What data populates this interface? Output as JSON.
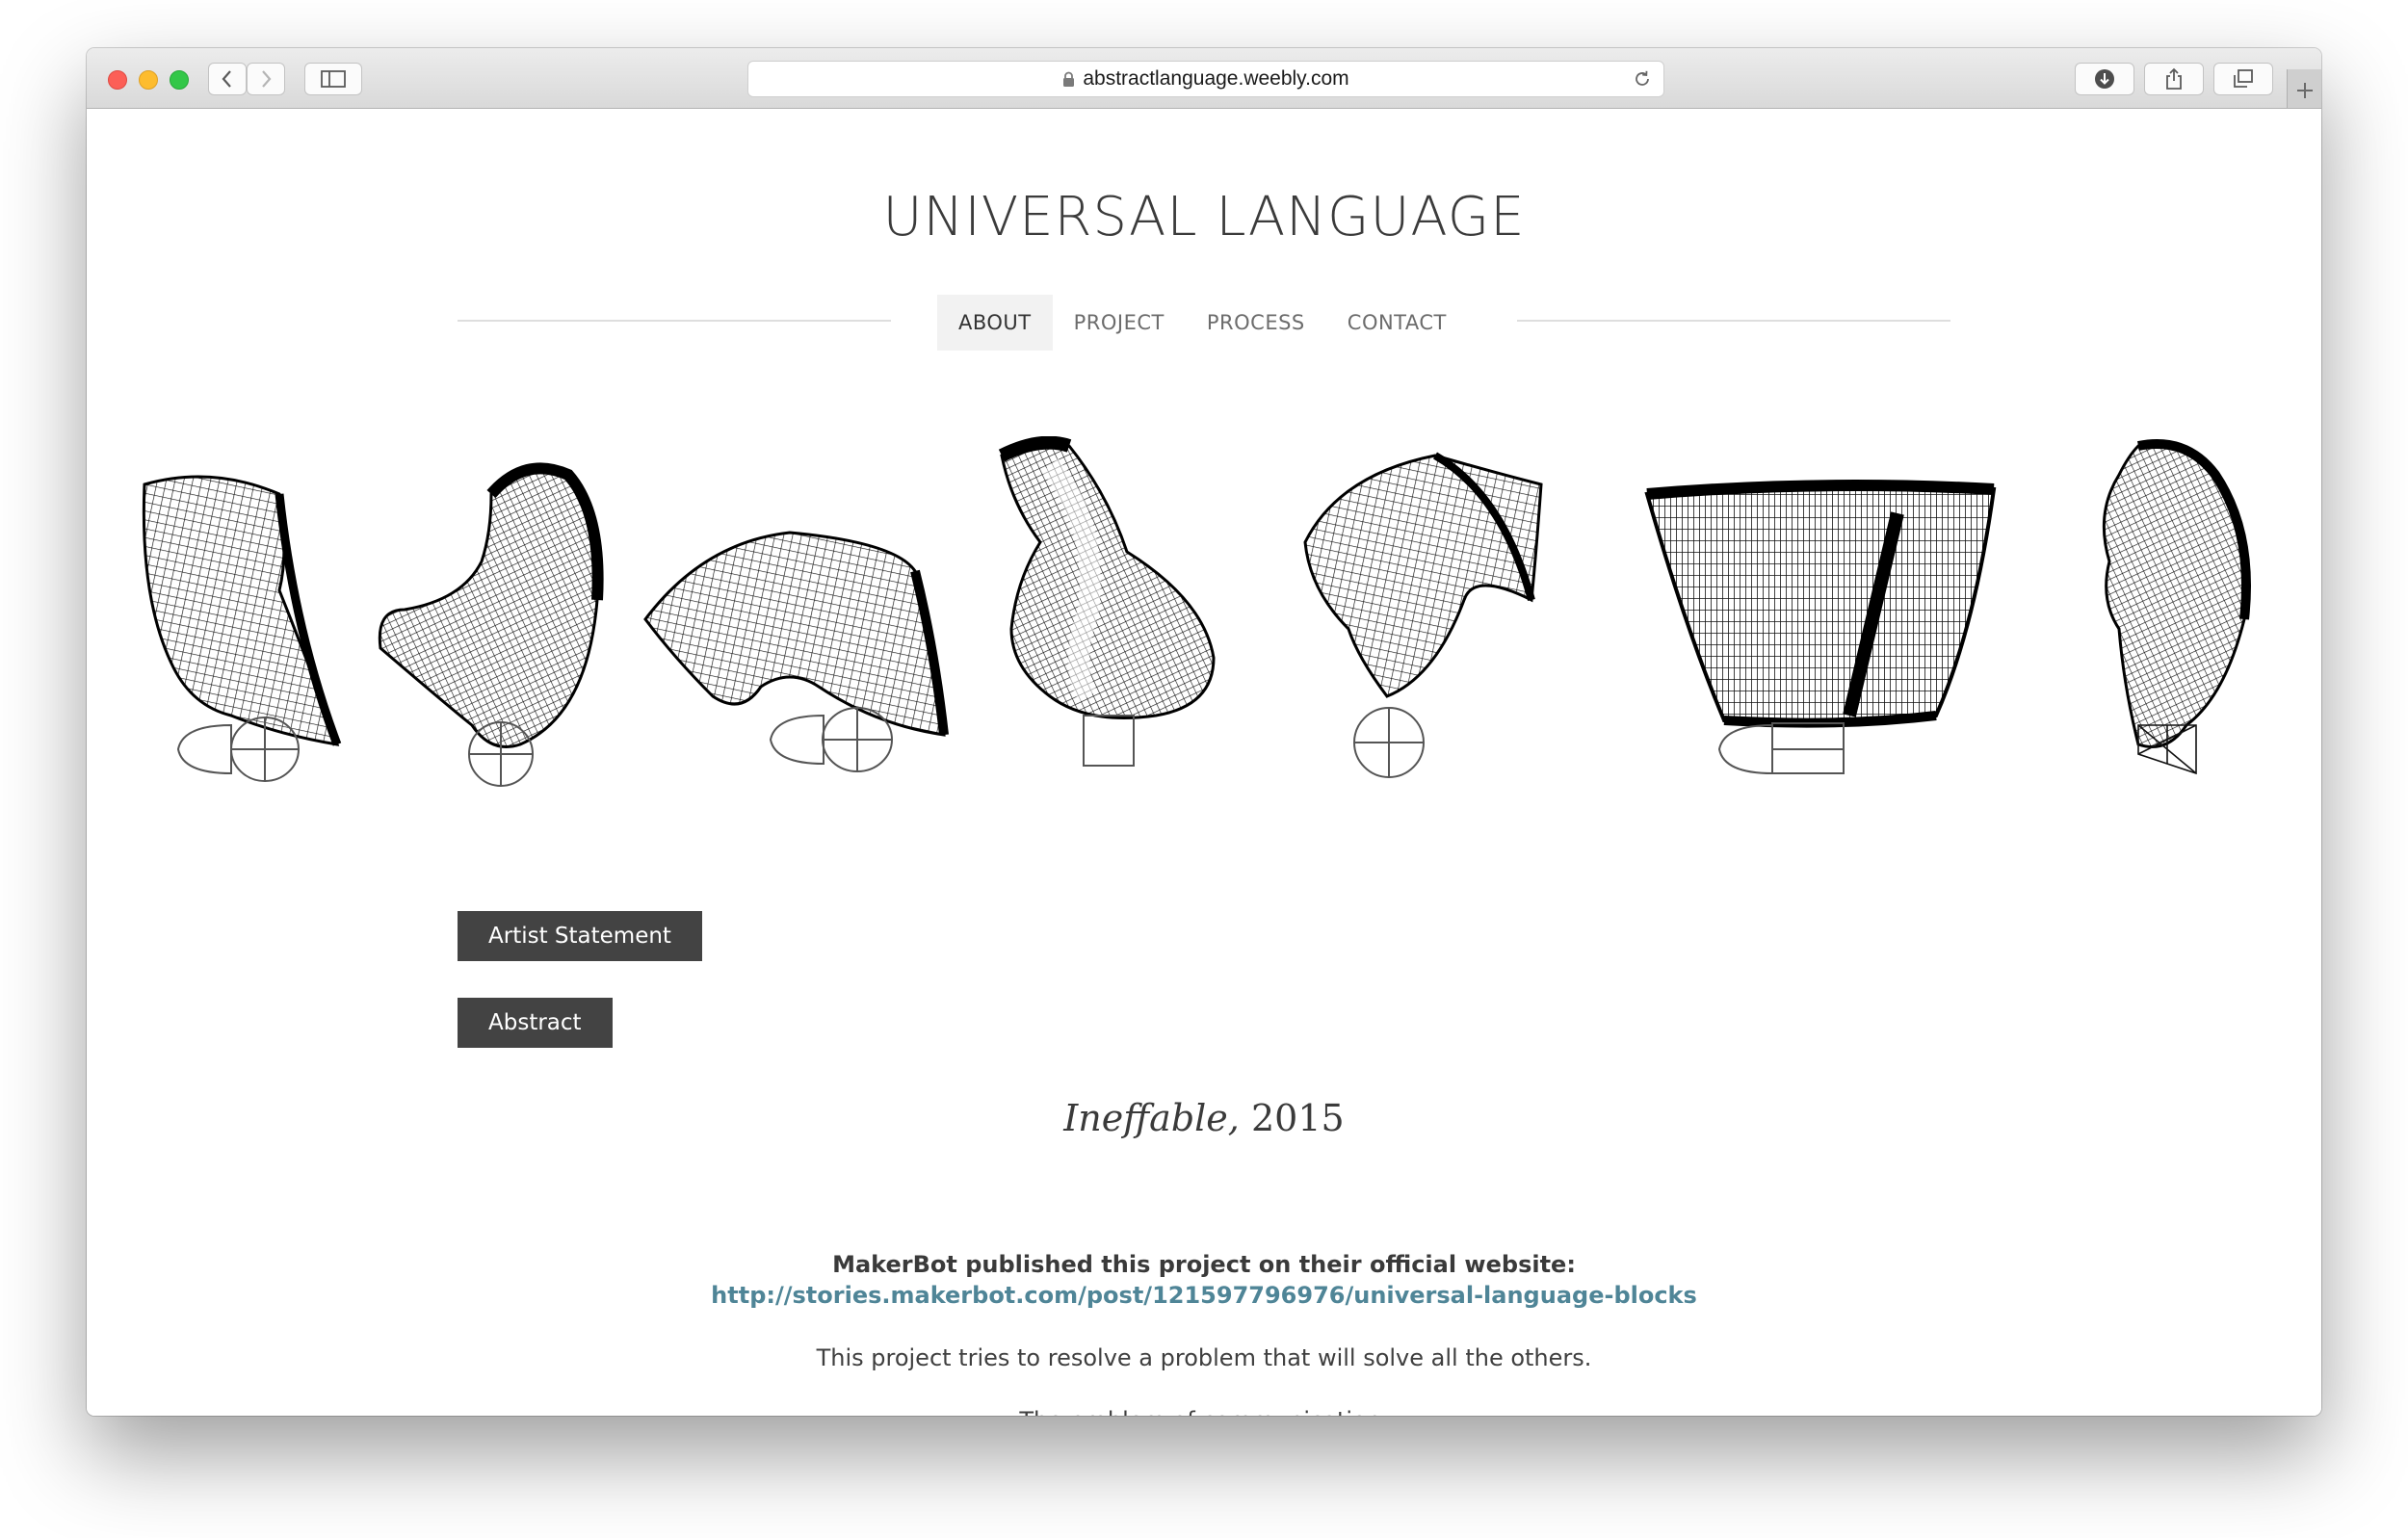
{
  "browser": {
    "url": "abstractlanguage.weebly.com"
  },
  "site": {
    "title": "UNIVERSAL LANGUAGE"
  },
  "nav": {
    "items": [
      {
        "label": "ABOUT",
        "active": true
      },
      {
        "label": "PROJECT",
        "active": false
      },
      {
        "label": "PROCESS",
        "active": false
      },
      {
        "label": "CONTACT",
        "active": false
      }
    ]
  },
  "buttons": {
    "artist_statement": "Artist Statement",
    "abstract": "Abstract"
  },
  "work": {
    "title": "Ineffable,",
    "year": "2015"
  },
  "content": {
    "makerbot_line": "MakerBot published this project on their official website:",
    "makerbot_link": "http://stories.makerbot.com/post/121597796976/universal-language-blocks",
    "intro": "This project tries to resolve a problem that will solve all the others.",
    "problem": "The problem of communication."
  },
  "colors": {
    "button_bg": "#434343",
    "link": "#4f8597",
    "nav_active_bg": "#f2f2f2"
  }
}
